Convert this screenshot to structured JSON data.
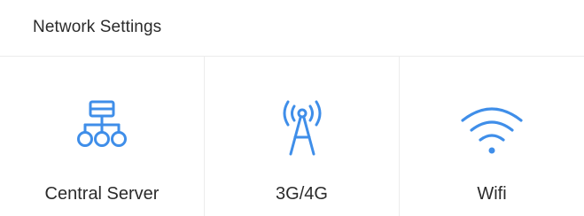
{
  "header": {
    "title": "Network Settings"
  },
  "tiles": [
    {
      "label": "Central Server",
      "icon": "sitemap-icon"
    },
    {
      "label": "3G/4G",
      "icon": "antenna-icon"
    },
    {
      "label": "Wifi",
      "icon": "wifi-icon"
    }
  ],
  "colors": {
    "accent": "#3f8ee9",
    "text": "#2b2b2b",
    "divider": "#ececec"
  }
}
